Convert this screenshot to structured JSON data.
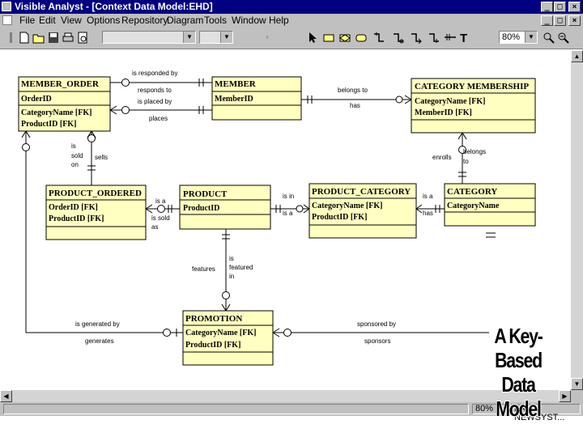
{
  "window": {
    "title": "Visible Analyst - [Context Data Model:EHD]"
  },
  "menu": [
    "File",
    "Edit",
    "View",
    "Options",
    "Repository",
    "Diagram",
    "Tools",
    "Window",
    "Help"
  ],
  "toolbar": {
    "zoom": "80%"
  },
  "status": {
    "zoom": "80%",
    "project": "PA - NEWSYST..."
  },
  "entities": {
    "member_order": {
      "name": "MEMBER_ORDER",
      "key": [
        "OrderID"
      ],
      "attrs": [
        "CategoryName [FK]",
        "ProductID [FK]"
      ]
    },
    "member": {
      "name": "MEMBER",
      "key": [
        "MemberID"
      ],
      "attrs": []
    },
    "category_membership": {
      "name": "CATEGORY MEMBERSHIP",
      "key": [
        "CategoryName [FK]",
        "MemberID [FK]"
      ],
      "attrs": []
    },
    "product_ordered": {
      "name": "PRODUCT_ORDERED",
      "key": [
        "OrderID [FK]",
        "ProductID [FK]"
      ],
      "attrs": []
    },
    "product": {
      "name": "PRODUCT",
      "key": [
        "ProductID"
      ],
      "attrs": []
    },
    "product_category": {
      "name": "PRODUCT_CATEGORY",
      "key": [
        "CategoryName [FK]",
        "ProductID [FK]"
      ],
      "attrs": []
    },
    "category": {
      "name": "CATEGORY",
      "key": [
        "CategoryName"
      ],
      "attrs": []
    },
    "promotion": {
      "name": "PROMOTION",
      "key": [
        "CategoryName [FK]",
        "ProductID [FK]"
      ],
      "attrs": []
    }
  },
  "relationships": {
    "is_responded_by": "is responded by",
    "responds_to": "responds to",
    "is_placed_by": "is placed by",
    "places": "places",
    "belongs_to_top": "belongs to",
    "has_top": "has",
    "is_sold_on_1": "is",
    "is_sold_on_2": "sold",
    "is_sold_on_3": "on",
    "sells": "sells",
    "enrolls": "enrolls",
    "belongs_to_right_1": "belongs",
    "belongs_to_right_2": "to",
    "is_a_1": "is a",
    "is_sold_as_1": "is sold",
    "is_sold_as_2": "as",
    "is_in": "is in",
    "is_a_2": "is a",
    "is_a_3": "is a",
    "has_right": "has",
    "features": "features",
    "is_featured_in_1": "is",
    "is_featured_in_2": "featured",
    "is_featured_in_3": "in",
    "is_generated_by": "is generated by",
    "generates": "generates",
    "sponsored_by": "sponsored by",
    "sponsors": "sponsors"
  },
  "overlay": {
    "line1": "A Key-Based",
    "line2": "Data Model"
  }
}
